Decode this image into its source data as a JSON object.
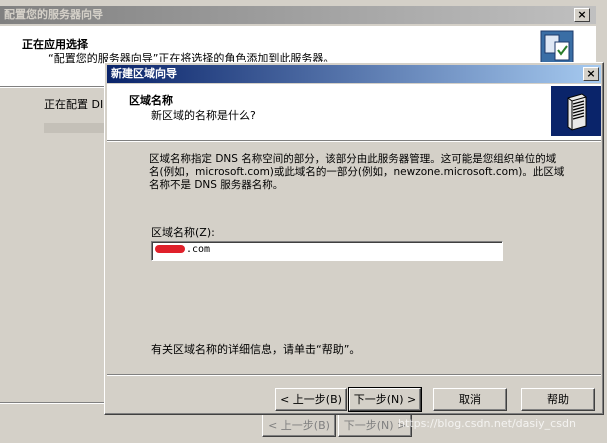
{
  "background_window": {
    "title": "配置您的服务器向导",
    "header_title": "正在应用选择",
    "header_subtitle": "“配置您的服务器向导”正在将选择的角色添加到此服务器。",
    "body_text": "正在配置 DI",
    "buttons": {
      "back": "< 上一步(B)",
      "next": "下一步(N) >"
    }
  },
  "dialog": {
    "title": "新建区域向导",
    "header_title": "区域名称",
    "header_subtitle": "新区域的名称是什么?",
    "description": "区域名称指定 DNS 名称空间的部分，该部分由此服务器管理。这可能是您组织单位的域名(例如，microsoft.com)或此域名的一部分(例如，newzone.microsoft.com)。此区域名称不是 DNS 服务器名称。",
    "zone_name_label": "区域名称(Z):",
    "zone_name_value": ".com",
    "help_hint": "有关区域名称的详细信息，请单击“帮助”。",
    "buttons": {
      "back": "< 上一步(B)",
      "next": "下一步(N) >",
      "cancel": "取消",
      "help": "帮助"
    }
  },
  "watermark": "https://blog.csdn.net/dasiy_csdn",
  "colors": {
    "titlebar_active": "#0a246a",
    "titlebar_inactive": "#808080",
    "dialog_face": "#d4d0c8",
    "redaction": "#e0202a"
  }
}
